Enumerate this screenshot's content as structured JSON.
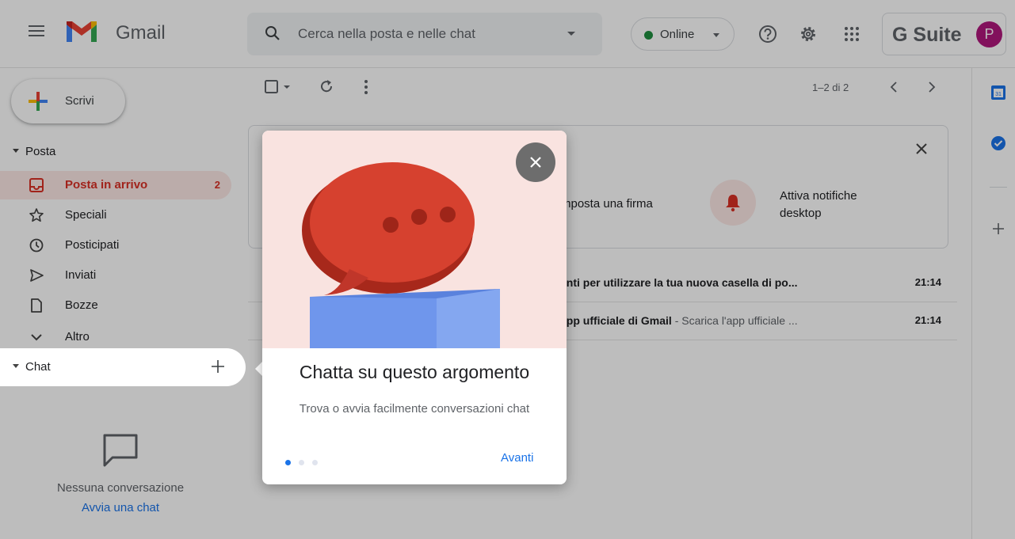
{
  "header": {
    "app_name": "Gmail",
    "search_placeholder": "Cerca nella posta e nelle chat",
    "status_label": "Online",
    "suite_label": "G Suite",
    "avatar_letter": "P"
  },
  "sidebar": {
    "compose_label": "Scrivi",
    "mail_section": "Posta",
    "items": [
      {
        "label": "Posta in arrivo",
        "count": "2",
        "icon": "inbox-icon"
      },
      {
        "label": "Speciali",
        "icon": "star-icon"
      },
      {
        "label": "Posticipati",
        "icon": "clock-icon"
      },
      {
        "label": "Inviati",
        "icon": "send-icon"
      },
      {
        "label": "Bozze",
        "icon": "draft-icon"
      },
      {
        "label": "Altro",
        "icon": "chevron-down-icon"
      }
    ],
    "chat_section": "Chat",
    "chat_empty": "Nessuna conversazione",
    "chat_start": "Avvia una chat"
  },
  "main": {
    "pager": "1–2 di 2",
    "setup_card": {
      "signature": "mposta una firma",
      "notifications": "Attiva notifiche desktop"
    },
    "emails": [
      {
        "subject": "enti per utilizzare la tua nuova casella di po...",
        "snippet": "",
        "time": "21:14"
      },
      {
        "subject": "app ufficiale di Gmail",
        "snippet": " - Scarica l'app ufficiale ...",
        "time": "21:14"
      }
    ]
  },
  "popup": {
    "title": "Chatta su questo argomento",
    "description": "Trova o avvia facilmente conversazioni chat",
    "next_label": "Avanti",
    "step": 1,
    "total_steps": 3
  },
  "colors": {
    "accent": "#1a73e8",
    "inbox_active": "#d93025",
    "avatar": "#b0187c",
    "online": "#1e8e3e"
  }
}
